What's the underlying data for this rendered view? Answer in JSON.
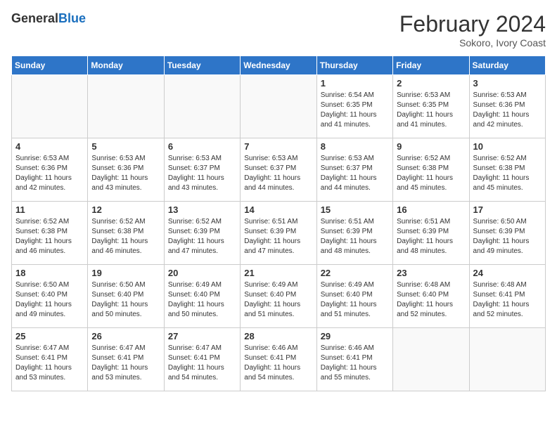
{
  "header": {
    "logo_general": "General",
    "logo_blue": "Blue",
    "month_title": "February 2024",
    "subtitle": "Sokoro, Ivory Coast"
  },
  "days_of_week": [
    "Sunday",
    "Monday",
    "Tuesday",
    "Wednesday",
    "Thursday",
    "Friday",
    "Saturday"
  ],
  "weeks": [
    [
      {
        "day": "",
        "info": ""
      },
      {
        "day": "",
        "info": ""
      },
      {
        "day": "",
        "info": ""
      },
      {
        "day": "",
        "info": ""
      },
      {
        "day": "1",
        "info": "Sunrise: 6:54 AM\nSunset: 6:35 PM\nDaylight: 11 hours\nand 41 minutes."
      },
      {
        "day": "2",
        "info": "Sunrise: 6:53 AM\nSunset: 6:35 PM\nDaylight: 11 hours\nand 41 minutes."
      },
      {
        "day": "3",
        "info": "Sunrise: 6:53 AM\nSunset: 6:36 PM\nDaylight: 11 hours\nand 42 minutes."
      }
    ],
    [
      {
        "day": "4",
        "info": "Sunrise: 6:53 AM\nSunset: 6:36 PM\nDaylight: 11 hours\nand 42 minutes."
      },
      {
        "day": "5",
        "info": "Sunrise: 6:53 AM\nSunset: 6:36 PM\nDaylight: 11 hours\nand 43 minutes."
      },
      {
        "day": "6",
        "info": "Sunrise: 6:53 AM\nSunset: 6:37 PM\nDaylight: 11 hours\nand 43 minutes."
      },
      {
        "day": "7",
        "info": "Sunrise: 6:53 AM\nSunset: 6:37 PM\nDaylight: 11 hours\nand 44 minutes."
      },
      {
        "day": "8",
        "info": "Sunrise: 6:53 AM\nSunset: 6:37 PM\nDaylight: 11 hours\nand 44 minutes."
      },
      {
        "day": "9",
        "info": "Sunrise: 6:52 AM\nSunset: 6:38 PM\nDaylight: 11 hours\nand 45 minutes."
      },
      {
        "day": "10",
        "info": "Sunrise: 6:52 AM\nSunset: 6:38 PM\nDaylight: 11 hours\nand 45 minutes."
      }
    ],
    [
      {
        "day": "11",
        "info": "Sunrise: 6:52 AM\nSunset: 6:38 PM\nDaylight: 11 hours\nand 46 minutes."
      },
      {
        "day": "12",
        "info": "Sunrise: 6:52 AM\nSunset: 6:38 PM\nDaylight: 11 hours\nand 46 minutes."
      },
      {
        "day": "13",
        "info": "Sunrise: 6:52 AM\nSunset: 6:39 PM\nDaylight: 11 hours\nand 47 minutes."
      },
      {
        "day": "14",
        "info": "Sunrise: 6:51 AM\nSunset: 6:39 PM\nDaylight: 11 hours\nand 47 minutes."
      },
      {
        "day": "15",
        "info": "Sunrise: 6:51 AM\nSunset: 6:39 PM\nDaylight: 11 hours\nand 48 minutes."
      },
      {
        "day": "16",
        "info": "Sunrise: 6:51 AM\nSunset: 6:39 PM\nDaylight: 11 hours\nand 48 minutes."
      },
      {
        "day": "17",
        "info": "Sunrise: 6:50 AM\nSunset: 6:39 PM\nDaylight: 11 hours\nand 49 minutes."
      }
    ],
    [
      {
        "day": "18",
        "info": "Sunrise: 6:50 AM\nSunset: 6:40 PM\nDaylight: 11 hours\nand 49 minutes."
      },
      {
        "day": "19",
        "info": "Sunrise: 6:50 AM\nSunset: 6:40 PM\nDaylight: 11 hours\nand 50 minutes."
      },
      {
        "day": "20",
        "info": "Sunrise: 6:49 AM\nSunset: 6:40 PM\nDaylight: 11 hours\nand 50 minutes."
      },
      {
        "day": "21",
        "info": "Sunrise: 6:49 AM\nSunset: 6:40 PM\nDaylight: 11 hours\nand 51 minutes."
      },
      {
        "day": "22",
        "info": "Sunrise: 6:49 AM\nSunset: 6:40 PM\nDaylight: 11 hours\nand 51 minutes."
      },
      {
        "day": "23",
        "info": "Sunrise: 6:48 AM\nSunset: 6:40 PM\nDaylight: 11 hours\nand 52 minutes."
      },
      {
        "day": "24",
        "info": "Sunrise: 6:48 AM\nSunset: 6:41 PM\nDaylight: 11 hours\nand 52 minutes."
      }
    ],
    [
      {
        "day": "25",
        "info": "Sunrise: 6:47 AM\nSunset: 6:41 PM\nDaylight: 11 hours\nand 53 minutes."
      },
      {
        "day": "26",
        "info": "Sunrise: 6:47 AM\nSunset: 6:41 PM\nDaylight: 11 hours\nand 53 minutes."
      },
      {
        "day": "27",
        "info": "Sunrise: 6:47 AM\nSunset: 6:41 PM\nDaylight: 11 hours\nand 54 minutes."
      },
      {
        "day": "28",
        "info": "Sunrise: 6:46 AM\nSunset: 6:41 PM\nDaylight: 11 hours\nand 54 minutes."
      },
      {
        "day": "29",
        "info": "Sunrise: 6:46 AM\nSunset: 6:41 PM\nDaylight: 11 hours\nand 55 minutes."
      },
      {
        "day": "",
        "info": ""
      },
      {
        "day": "",
        "info": ""
      }
    ]
  ]
}
